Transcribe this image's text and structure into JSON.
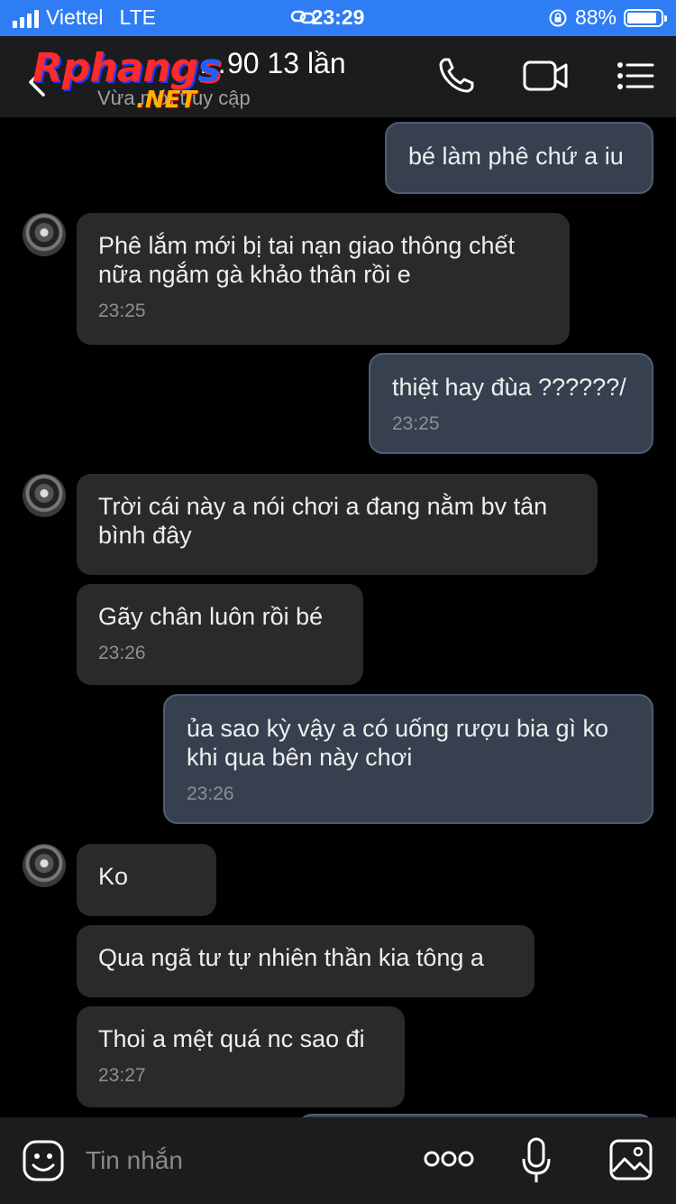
{
  "status_bar": {
    "carrier": "Viettel",
    "network": "LTE",
    "time": "23:29",
    "battery": "88%",
    "battery_level": 0.88
  },
  "header": {
    "watermark_main_a": "Rphang",
    "watermark_main_b": "s",
    "watermark_sub": ".NET",
    "contact_name": "…90 13 lần",
    "contact_status": "Vừa mới truy cập",
    "icons": [
      "back-icon",
      "phone-icon",
      "video-call-icon",
      "menu-icon"
    ]
  },
  "messages": [
    {
      "direction": "out",
      "text": "bé làm phê chứ a iu",
      "time": ""
    },
    {
      "direction": "in",
      "text": "Phê lắm mới bị tai nạn giao thông chết nữa ngắm gà khảo thân rồi e",
      "time": "23:25"
    },
    {
      "direction": "out",
      "text": "thiệt hay đùa ??????/",
      "time": "23:25"
    },
    {
      "direction": "in",
      "text": "Trời cái này a nói chơi a đang nằm bv tân bình đây",
      "time": ""
    },
    {
      "direction": "in",
      "text": "Gãy chân luôn rồi bé",
      "time": "23:26"
    },
    {
      "direction": "out",
      "text": "ủa sao kỳ vậy a có uống rượu bia gì ko khi qua bên này chơi",
      "time": "23:26"
    },
    {
      "direction": "in",
      "text": "Ko",
      "time": ""
    },
    {
      "direction": "in",
      "text": "Qua ngã tư tự nhiên thần kia tông a",
      "time": ""
    },
    {
      "direction": "in",
      "text": "Thoi a mệt quá nc sao đi",
      "time": "23:27"
    }
  ],
  "composer": {
    "placeholder": "Tin nhắn",
    "icons": [
      "emoji-icon",
      "more-icon",
      "microphone-icon",
      "image-icon"
    ]
  }
}
